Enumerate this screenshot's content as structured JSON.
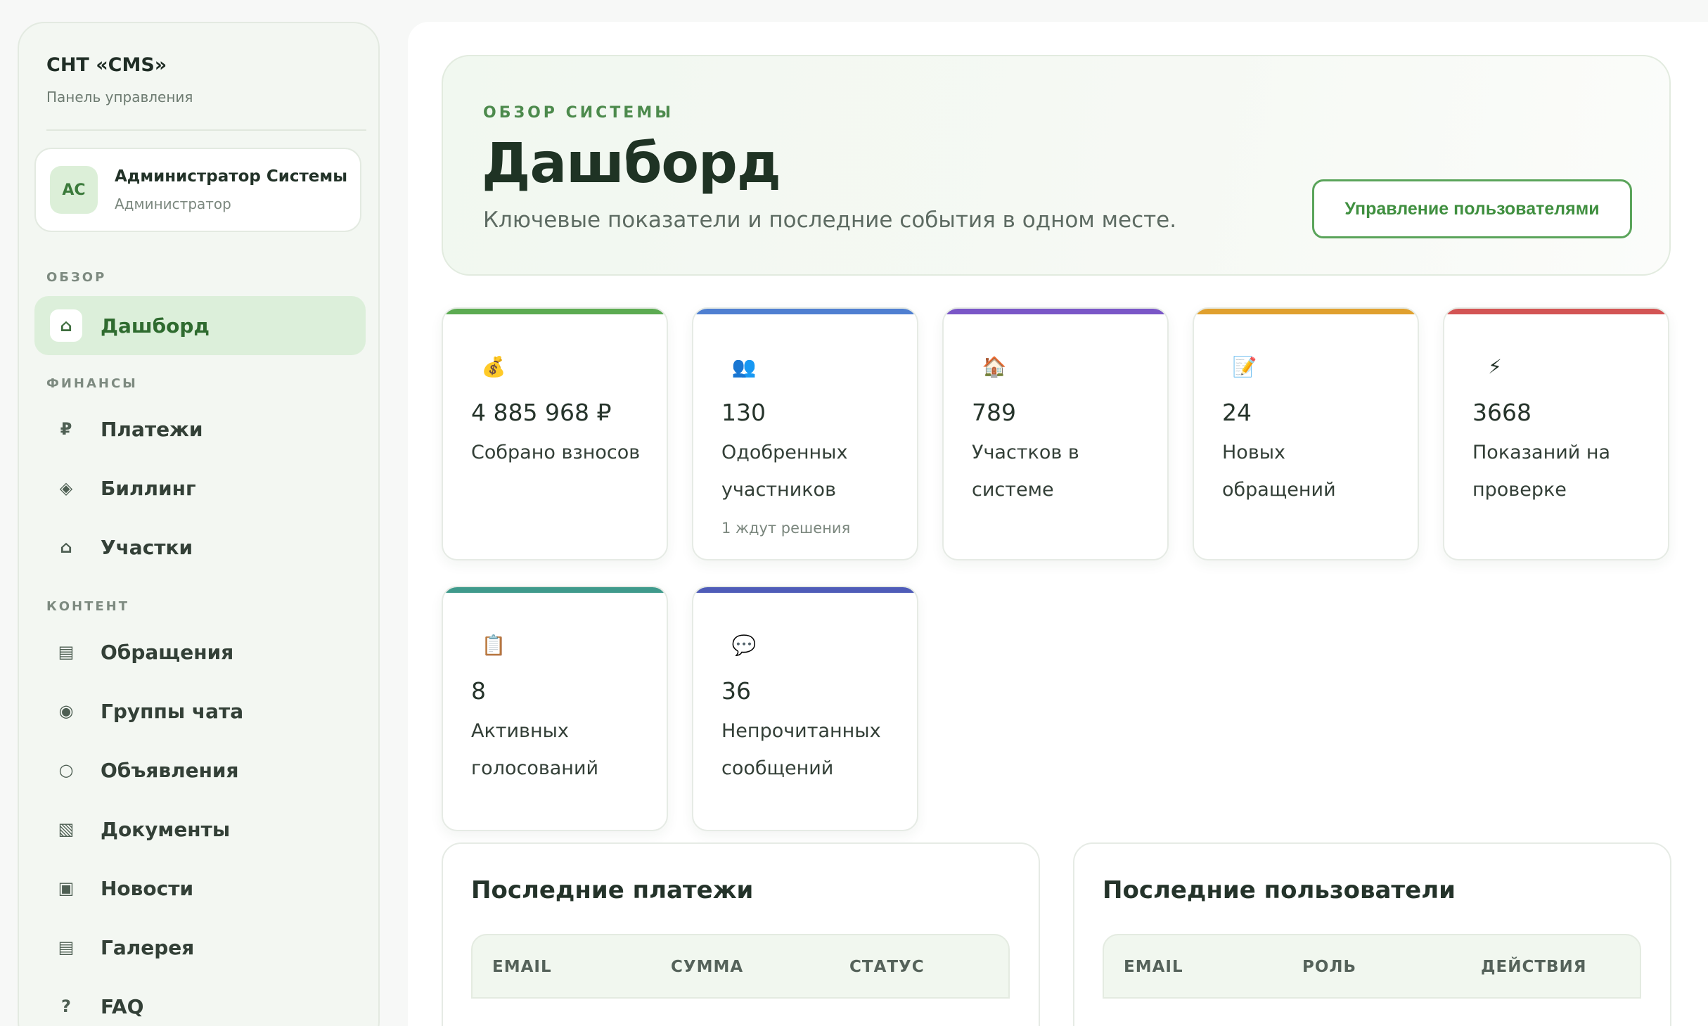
{
  "sidebar": {
    "brand_title": "СНТ «CMS»",
    "brand_subtitle": "Панель управления",
    "user": {
      "initials": "АС",
      "name": "Администратор Системы",
      "role": "Администратор"
    },
    "sections": [
      {
        "title": "ОБЗОР",
        "items": [
          {
            "label": "Дашборд",
            "icon": "⌂",
            "icon_name": "home-icon",
            "active": true
          }
        ]
      },
      {
        "title": "ФИНАНСЫ",
        "items": [
          {
            "label": "Платежи",
            "icon": "₽",
            "icon_name": "ruble-icon"
          },
          {
            "label": "Биллинг",
            "icon": "◈",
            "icon_name": "diamond-icon"
          },
          {
            "label": "Участки",
            "icon": "⌂",
            "icon_name": "home-icon"
          }
        ]
      },
      {
        "title": "КОНТЕНТ",
        "items": [
          {
            "label": "Обращения",
            "icon": "▤",
            "icon_name": "list-icon"
          },
          {
            "label": "Группы чата",
            "icon": "◉",
            "icon_name": "circle-dot-icon"
          },
          {
            "label": "Объявления",
            "icon": "○",
            "icon_name": "circle-icon"
          },
          {
            "label": "Документы",
            "icon": "▧",
            "icon_name": "document-icon"
          },
          {
            "label": "Новости",
            "icon": "▣",
            "icon_name": "news-icon"
          },
          {
            "label": "Галерея",
            "icon": "▤",
            "icon_name": "gallery-icon"
          },
          {
            "label": "FAQ",
            "icon": "?",
            "icon_name": "question-icon"
          }
        ]
      }
    ]
  },
  "hero": {
    "eyebrow": "ОБЗОР СИСТЕМЫ",
    "title": "Дашборд",
    "subtitle": "Ключевые показатели и последние события в одном месте.",
    "button_label": "Управление пользователями"
  },
  "stats": [
    {
      "icon": "💰",
      "icon_name": "money-bag-icon",
      "value": "4 885 968 ₽",
      "label": "Собрано взносов",
      "note": "",
      "accent": "#5cab52"
    },
    {
      "icon": "👥",
      "icon_name": "users-icon",
      "value": "130",
      "label": "Одобренных участников",
      "note": "1 ждут решения",
      "accent": "#4f7fd1"
    },
    {
      "icon": "🏠",
      "icon_name": "house-icon",
      "value": "789",
      "label": "Участков в системе",
      "note": "",
      "accent": "#7a56c7"
    },
    {
      "icon": "📝",
      "icon_name": "memo-icon",
      "value": "24",
      "label": "Новых обращений",
      "note": "",
      "accent": "#e0a02e"
    },
    {
      "icon": "⚡",
      "icon_name": "lightning-icon",
      "value": "3668",
      "label": "Показаний на проверке",
      "note": "",
      "accent": "#d35454"
    },
    {
      "icon": "📋",
      "icon_name": "clipboard-icon",
      "value": "8",
      "label": "Активных голосований",
      "note": "",
      "accent": "#3f9a8c"
    },
    {
      "icon": "💬",
      "icon_name": "speech-bubble-icon",
      "value": "36",
      "label": "Непрочитанных сообщений",
      "note": "",
      "accent": "#4f5cb8"
    }
  ],
  "panels": {
    "payments": {
      "title": "Последние платежи",
      "columns": [
        "EMAIL",
        "СУММА",
        "СТАТУС"
      ]
    },
    "users": {
      "title": "Последние пользователи",
      "columns": [
        "EMAIL",
        "РОЛЬ",
        "ДЕЙСТВИЯ"
      ]
    }
  }
}
